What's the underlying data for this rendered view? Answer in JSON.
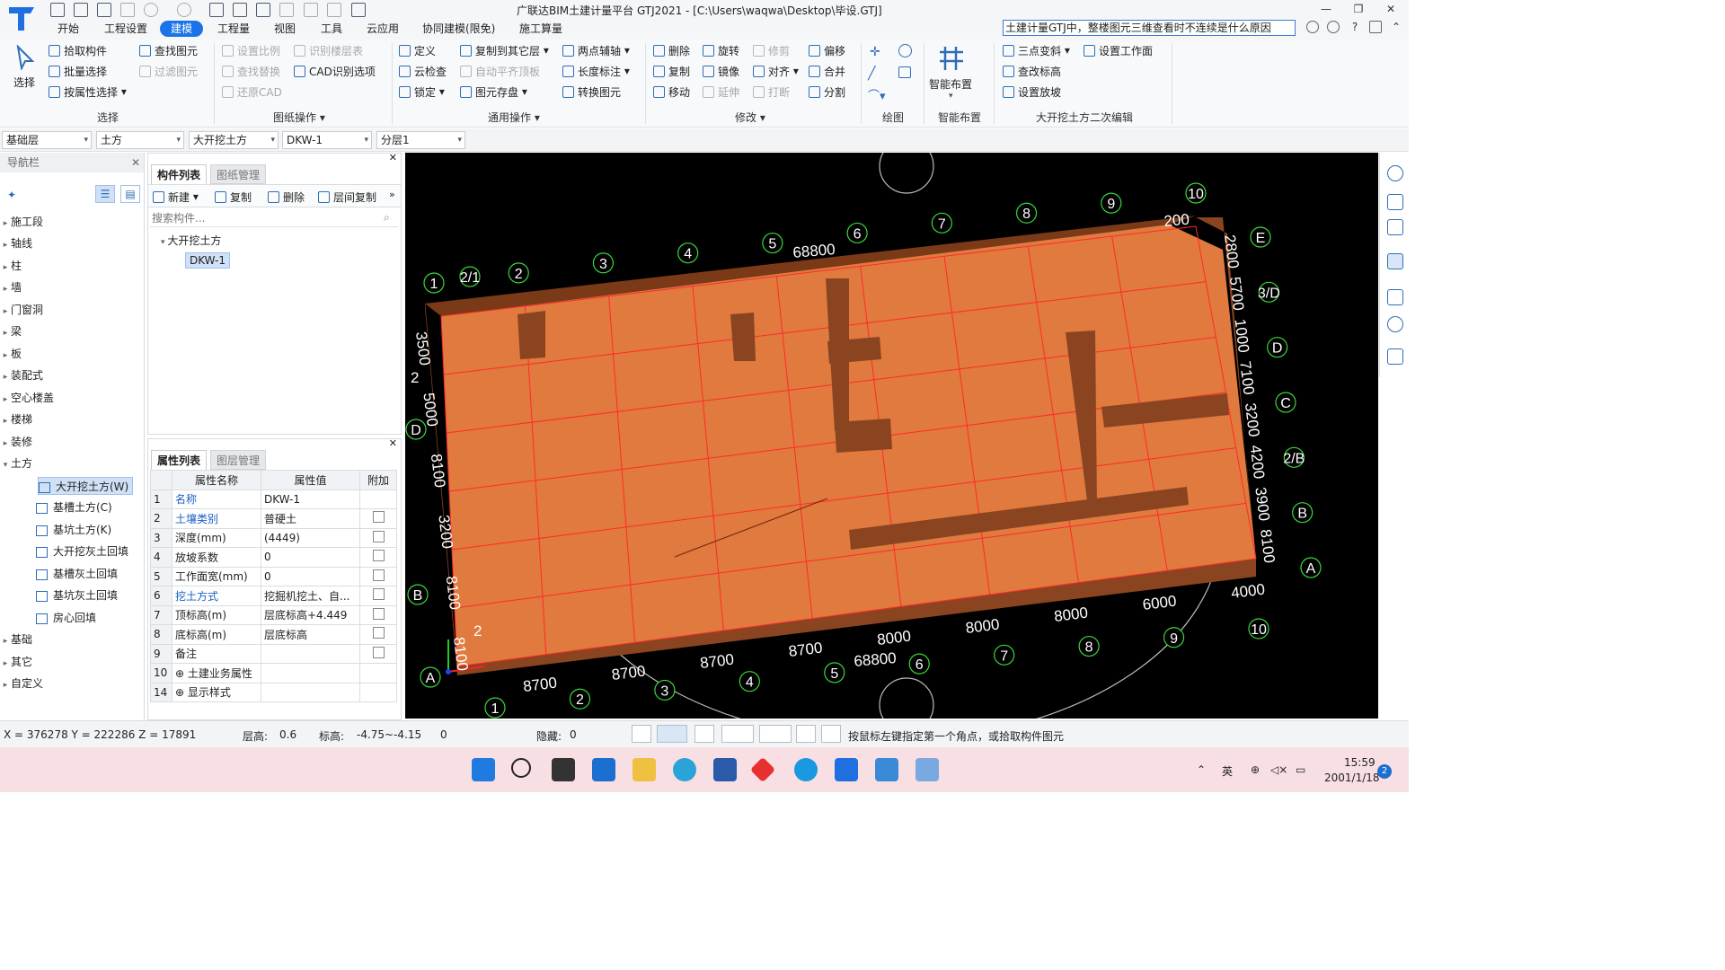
{
  "window": {
    "title": "广联达BIM土建计量平台 GTJ2021 - [C:\\Users\\waqwa\\Desktop\\毕设.GTJ]",
    "min_label": "—",
    "restore_label": "❐",
    "close_label": "✕"
  },
  "menu": {
    "tabs": [
      "开始",
      "工程设置",
      "建模",
      "工程量",
      "视图",
      "工具",
      "云应用",
      "协同建模(限免)",
      "施工算量"
    ],
    "search_value": "土建计量GTJ中，整楼图元三维查看时不连续是什么原因",
    "qa_label": "?"
  },
  "ribbon": {
    "select_label": "选择",
    "group_select": [
      "拾取构件",
      "批量选择",
      "按属性选择",
      "查找图元",
      "过滤图元"
    ],
    "group_drawing": [
      "设置比例",
      "识别楼层表",
      "查找替换",
      "CAD识别选项",
      "还原CAD"
    ],
    "group_common": [
      "定义",
      "复制到其它层",
      "两点辅轴",
      "云检查",
      "自动平齐顶板",
      "长度标注",
      "锁定",
      "图元存盘",
      "转换图元"
    ],
    "group_modify": [
      "删除",
      "旋转",
      "修剪",
      "偏移",
      "复制",
      "镜像",
      "对齐",
      "合并",
      "移动",
      "延伸",
      "打断",
      "分割"
    ],
    "smart_label": "智能布置",
    "group_edit": [
      "三点变斜",
      "设置工作面",
      "查改标高",
      "设置放坡"
    ],
    "labels": {
      "select": "选择",
      "drawing": "图纸操作",
      "common": "通用操作",
      "modify": "修改",
      "draw": "绘图",
      "smart": "智能布置",
      "edit": "大开挖土方二次编辑"
    }
  },
  "selectors": [
    "基础层",
    "土方",
    "大开挖土方",
    "DKW-1",
    "分层1"
  ],
  "nav": {
    "title": "导航栏",
    "items": [
      "施工段",
      "轴线",
      "柱",
      "墙",
      "门窗洞",
      "梁",
      "板",
      "装配式",
      "空心楼盖",
      "楼梯",
      "装修",
      "土方",
      "基础",
      "其它",
      "自定义"
    ],
    "sub_items": [
      "大开挖土方(W)",
      "基槽土方(C)",
      "基坑土方(K)",
      "大开挖灰土回填",
      "基槽灰土回填",
      "基坑灰土回填",
      "房心回填"
    ]
  },
  "component_panel": {
    "tab_active": "构件列表",
    "tab_inactive": "图纸管理",
    "toolbar": [
      "新建",
      "复制",
      "删除",
      "层间复制"
    ],
    "search_placeholder": "搜索构件...",
    "tree_parent": "大开挖土方",
    "tree_child": "DKW-1"
  },
  "property_panel": {
    "tab_active": "属性列表",
    "tab_inactive": "图层管理",
    "headers": [
      "属性名称",
      "属性值",
      "附加"
    ],
    "rows": [
      {
        "no": "1",
        "name": "名称",
        "value": "DKW-1",
        "link": true,
        "check": false
      },
      {
        "no": "2",
        "name": "土壤类别",
        "value": "普硬土",
        "link": true,
        "check": true
      },
      {
        "no": "3",
        "name": "深度(mm)",
        "value": "(4449)",
        "link": false,
        "check": true
      },
      {
        "no": "4",
        "name": "放坡系数",
        "value": "0",
        "link": false,
        "check": true
      },
      {
        "no": "5",
        "name": "工作面宽(mm)",
        "value": "0",
        "link": false,
        "check": true
      },
      {
        "no": "6",
        "name": "挖土方式",
        "value": "挖掘机挖土、自...",
        "link": true,
        "check": true
      },
      {
        "no": "7",
        "name": "顶标高(m)",
        "value": "层底标高+4.449",
        "link": false,
        "check": true
      },
      {
        "no": "8",
        "name": "底标高(m)",
        "value": "层底标高",
        "link": false,
        "check": true
      },
      {
        "no": "9",
        "name": "备注",
        "value": "",
        "link": false,
        "check": true
      },
      {
        "no": "10",
        "name": "⊕ 土建业务属性",
        "value": "",
        "link": false,
        "check": false
      },
      {
        "no": "14",
        "name": "⊕ 显示样式",
        "value": "",
        "link": false,
        "check": false
      }
    ]
  },
  "viewport": {
    "axis_labels_top": [
      "1",
      "2/1",
      "2",
      "3",
      "4",
      "5",
      "6",
      "7",
      "8",
      "9",
      "10"
    ],
    "axis_labels_bottom": [
      "1",
      "2",
      "3",
      "4",
      "5",
      "6",
      "7",
      "8",
      "9",
      "10"
    ],
    "axis_labels_right": [
      "E",
      "3/D",
      "D",
      "C",
      "2/B",
      "B",
      "A"
    ],
    "axis_labels_left": [
      "D",
      "B",
      "A"
    ],
    "dims_bottom": [
      "8700",
      "8700",
      "8700",
      "8700",
      "8000",
      "8000",
      "8000",
      "6000",
      "4000"
    ],
    "dims_right": [
      "2800",
      "5700",
      "1000",
      "7100",
      "3200",
      "4200",
      "3900",
      "8100"
    ],
    "dims_left": [
      "3500",
      "5000",
      "8100",
      "3200",
      "8100",
      "8100"
    ],
    "total_top": "68800",
    "total_bottom": "68800",
    "fragment_top_right": "200",
    "fragment_left": "2",
    "fragment_bottom_left": "2",
    "colors": {
      "earth_top": "#e07a3e",
      "earth_side": "#8a4420",
      "grid": "#ff2a2a",
      "axis": "#39d839"
    }
  },
  "status": {
    "coords": "X = 376278 Y = 222286 Z = 17891",
    "floor_height_label": "层高:",
    "floor_height": "0.6",
    "elev_label": "标高:",
    "elev": "-4.75~-4.15",
    "zero": "0",
    "hidden_label": "隐藏:",
    "hidden": "0",
    "hint": "按鼠标左键指定第一个角点，或拾取构件图元"
  },
  "taskbar": {
    "ime": "英",
    "time": "15:59",
    "date": "2001/1/18",
    "badge": "2"
  }
}
